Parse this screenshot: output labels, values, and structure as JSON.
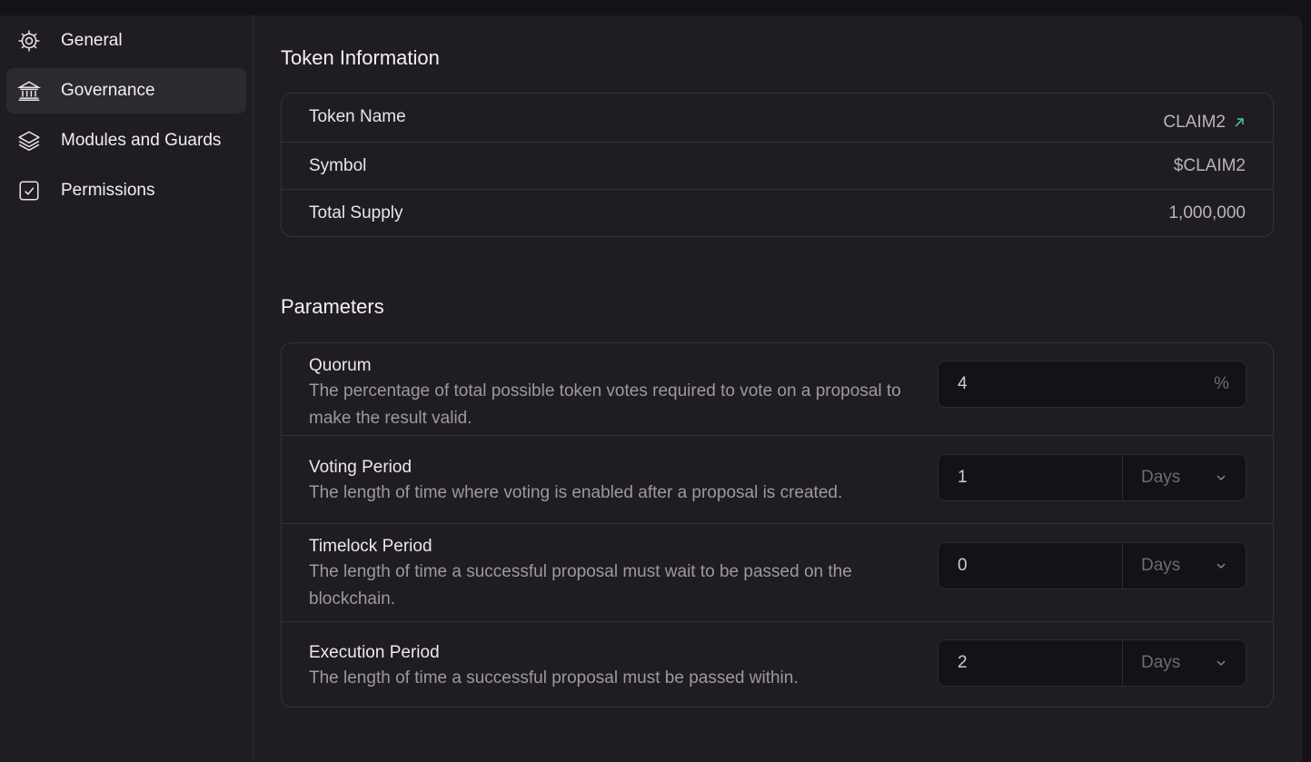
{
  "sidebar": {
    "items": [
      {
        "label": "General",
        "icon": "gear-icon",
        "active": false
      },
      {
        "label": "Governance",
        "icon": "bank-icon",
        "active": true
      },
      {
        "label": "Modules and Guards",
        "icon": "layers-icon",
        "active": false
      },
      {
        "label": "Permissions",
        "icon": "checkbox-icon",
        "active": false
      }
    ]
  },
  "token_info": {
    "title": "Token Information",
    "rows": [
      {
        "label": "Token Name",
        "value": "CLAIM2",
        "link": true
      },
      {
        "label": "Symbol",
        "value": "$CLAIM2"
      },
      {
        "label": "Total Supply",
        "value": "1,000,000"
      }
    ]
  },
  "parameters": {
    "title": "Parameters",
    "rows": [
      {
        "title": "Quorum",
        "description": "The percentage of total possible token votes required to vote on a proposal to make the result valid.",
        "value": "4",
        "suffix": "%"
      },
      {
        "title": "Voting Period",
        "description": "The length of time where voting is enabled after a proposal is created.",
        "value": "1",
        "unit": "Days"
      },
      {
        "title": "Timelock Period",
        "description": "The length of time a successful proposal must wait to be passed on the blockchain.",
        "value": "0",
        "unit": "Days"
      },
      {
        "title": "Execution Period",
        "description": "The length of time a successful proposal must be passed within.",
        "value": "2",
        "unit": "Days"
      }
    ]
  },
  "colors": {
    "accent_link": "#4fd0a0",
    "background": "#1f1c22",
    "active_nav": "#2c2930"
  }
}
